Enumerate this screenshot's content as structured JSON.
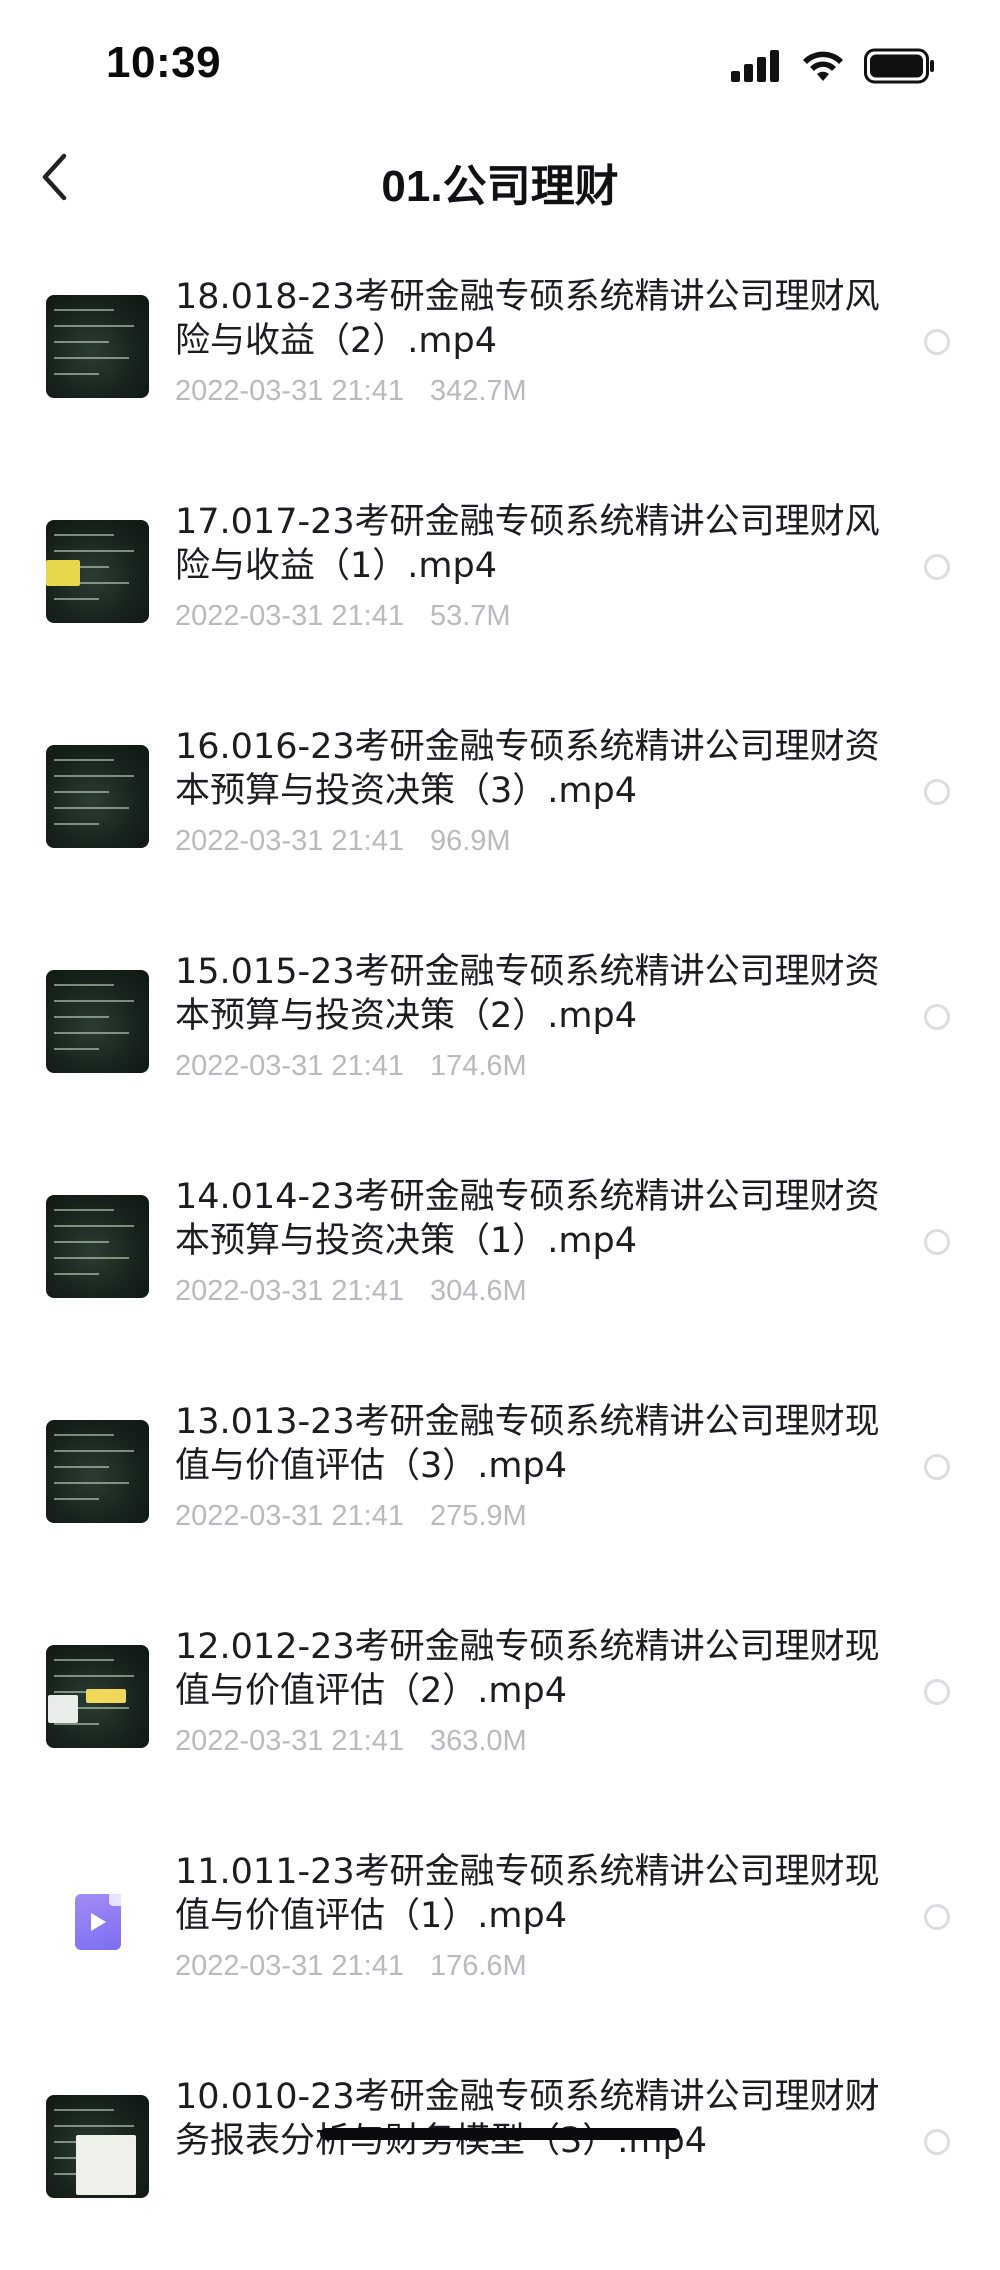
{
  "status_bar": {
    "time": "10:39",
    "icons": [
      "signal-icon",
      "wifi-icon",
      "battery-icon"
    ]
  },
  "nav": {
    "back_icon": "chevron-left-icon",
    "title": "01.公司理财"
  },
  "colors": {
    "title_text": "#1c1c22",
    "meta_text": "#b9bac0",
    "radio_border": "#dcdde1",
    "file_icon": "#8a7cf3"
  },
  "files": [
    {
      "title": "18.018-23考研金融专硕系统精讲公司理财风险与收益（2）.mp4",
      "date": "2022-03-31 21:41",
      "size": "342.7M",
      "thumb": "video",
      "accent": "none"
    },
    {
      "title": "17.017-23考研金融专硕系统精讲公司理财风险与收益（1）.mp4",
      "date": "2022-03-31 21:41",
      "size": "53.7M",
      "thumb": "video",
      "accent": "yellow"
    },
    {
      "title": "16.016-23考研金融专硕系统精讲公司理财资本预算与投资决策（3）.mp4",
      "date": "2022-03-31 21:41",
      "size": "96.9M",
      "thumb": "video",
      "accent": "none"
    },
    {
      "title": "15.015-23考研金融专硕系统精讲公司理财资本预算与投资决策（2）.mp4",
      "date": "2022-03-31 21:41",
      "size": "174.6M",
      "thumb": "video",
      "accent": "none"
    },
    {
      "title": "14.014-23考研金融专硕系统精讲公司理财资本预算与投资决策（1）.mp4",
      "date": "2022-03-31 21:41",
      "size": "304.6M",
      "thumb": "video",
      "accent": "none"
    },
    {
      "title": "13.013-23考研金融专硕系统精讲公司理财现值与价值评估（3）.mp4",
      "date": "2022-03-31 21:41",
      "size": "275.9M",
      "thumb": "video",
      "accent": "none"
    },
    {
      "title": "12.012-23考研金融专硕系统精讲公司理财现值与价值评估（2）.mp4",
      "date": "2022-03-31 21:41",
      "size": "363.0M",
      "thumb": "video",
      "accent": "yellow-small"
    },
    {
      "title": "11.011-23考研金融专硕系统精讲公司理财现值与价值评估（1）.mp4",
      "date": "2022-03-31 21:41",
      "size": "176.6M",
      "thumb": "file",
      "accent": "none"
    },
    {
      "title": "10.010-23考研金融专硕系统精讲公司理财财务报表分析与财务模型（3）.mp4",
      "date": "",
      "size": "",
      "thumb": "video",
      "accent": "chart"
    }
  ]
}
